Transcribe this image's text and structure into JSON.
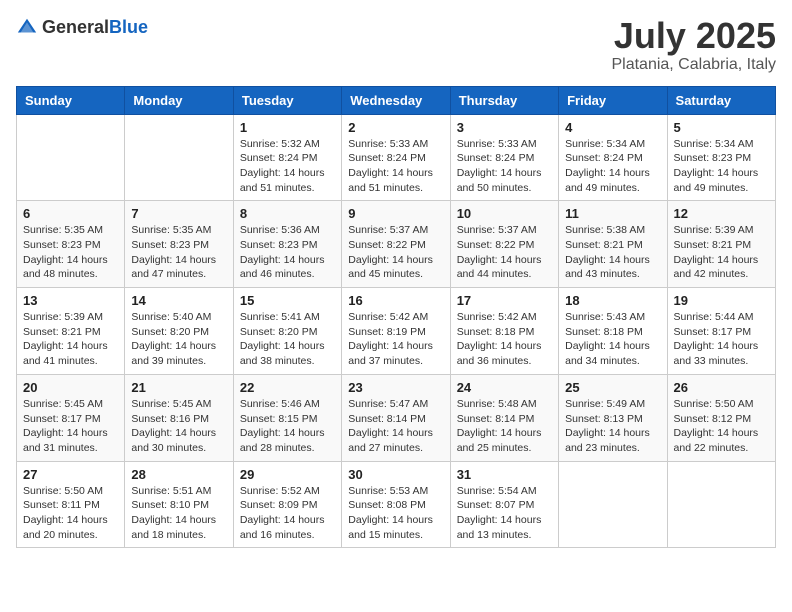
{
  "header": {
    "logo_general": "General",
    "logo_blue": "Blue",
    "month_title": "July 2025",
    "subtitle": "Platania, Calabria, Italy"
  },
  "weekdays": [
    "Sunday",
    "Monday",
    "Tuesday",
    "Wednesday",
    "Thursday",
    "Friday",
    "Saturday"
  ],
  "weeks": [
    [
      {
        "day": "",
        "sunrise": "",
        "sunset": "",
        "daylight": ""
      },
      {
        "day": "",
        "sunrise": "",
        "sunset": "",
        "daylight": ""
      },
      {
        "day": "1",
        "sunrise": "Sunrise: 5:32 AM",
        "sunset": "Sunset: 8:24 PM",
        "daylight": "Daylight: 14 hours and 51 minutes."
      },
      {
        "day": "2",
        "sunrise": "Sunrise: 5:33 AM",
        "sunset": "Sunset: 8:24 PM",
        "daylight": "Daylight: 14 hours and 51 minutes."
      },
      {
        "day": "3",
        "sunrise": "Sunrise: 5:33 AM",
        "sunset": "Sunset: 8:24 PM",
        "daylight": "Daylight: 14 hours and 50 minutes."
      },
      {
        "day": "4",
        "sunrise": "Sunrise: 5:34 AM",
        "sunset": "Sunset: 8:24 PM",
        "daylight": "Daylight: 14 hours and 49 minutes."
      },
      {
        "day": "5",
        "sunrise": "Sunrise: 5:34 AM",
        "sunset": "Sunset: 8:23 PM",
        "daylight": "Daylight: 14 hours and 49 minutes."
      }
    ],
    [
      {
        "day": "6",
        "sunrise": "Sunrise: 5:35 AM",
        "sunset": "Sunset: 8:23 PM",
        "daylight": "Daylight: 14 hours and 48 minutes."
      },
      {
        "day": "7",
        "sunrise": "Sunrise: 5:35 AM",
        "sunset": "Sunset: 8:23 PM",
        "daylight": "Daylight: 14 hours and 47 minutes."
      },
      {
        "day": "8",
        "sunrise": "Sunrise: 5:36 AM",
        "sunset": "Sunset: 8:23 PM",
        "daylight": "Daylight: 14 hours and 46 minutes."
      },
      {
        "day": "9",
        "sunrise": "Sunrise: 5:37 AM",
        "sunset": "Sunset: 8:22 PM",
        "daylight": "Daylight: 14 hours and 45 minutes."
      },
      {
        "day": "10",
        "sunrise": "Sunrise: 5:37 AM",
        "sunset": "Sunset: 8:22 PM",
        "daylight": "Daylight: 14 hours and 44 minutes."
      },
      {
        "day": "11",
        "sunrise": "Sunrise: 5:38 AM",
        "sunset": "Sunset: 8:21 PM",
        "daylight": "Daylight: 14 hours and 43 minutes."
      },
      {
        "day": "12",
        "sunrise": "Sunrise: 5:39 AM",
        "sunset": "Sunset: 8:21 PM",
        "daylight": "Daylight: 14 hours and 42 minutes."
      }
    ],
    [
      {
        "day": "13",
        "sunrise": "Sunrise: 5:39 AM",
        "sunset": "Sunset: 8:21 PM",
        "daylight": "Daylight: 14 hours and 41 minutes."
      },
      {
        "day": "14",
        "sunrise": "Sunrise: 5:40 AM",
        "sunset": "Sunset: 8:20 PM",
        "daylight": "Daylight: 14 hours and 39 minutes."
      },
      {
        "day": "15",
        "sunrise": "Sunrise: 5:41 AM",
        "sunset": "Sunset: 8:20 PM",
        "daylight": "Daylight: 14 hours and 38 minutes."
      },
      {
        "day": "16",
        "sunrise": "Sunrise: 5:42 AM",
        "sunset": "Sunset: 8:19 PM",
        "daylight": "Daylight: 14 hours and 37 minutes."
      },
      {
        "day": "17",
        "sunrise": "Sunrise: 5:42 AM",
        "sunset": "Sunset: 8:18 PM",
        "daylight": "Daylight: 14 hours and 36 minutes."
      },
      {
        "day": "18",
        "sunrise": "Sunrise: 5:43 AM",
        "sunset": "Sunset: 8:18 PM",
        "daylight": "Daylight: 14 hours and 34 minutes."
      },
      {
        "day": "19",
        "sunrise": "Sunrise: 5:44 AM",
        "sunset": "Sunset: 8:17 PM",
        "daylight": "Daylight: 14 hours and 33 minutes."
      }
    ],
    [
      {
        "day": "20",
        "sunrise": "Sunrise: 5:45 AM",
        "sunset": "Sunset: 8:17 PM",
        "daylight": "Daylight: 14 hours and 31 minutes."
      },
      {
        "day": "21",
        "sunrise": "Sunrise: 5:45 AM",
        "sunset": "Sunset: 8:16 PM",
        "daylight": "Daylight: 14 hours and 30 minutes."
      },
      {
        "day": "22",
        "sunrise": "Sunrise: 5:46 AM",
        "sunset": "Sunset: 8:15 PM",
        "daylight": "Daylight: 14 hours and 28 minutes."
      },
      {
        "day": "23",
        "sunrise": "Sunrise: 5:47 AM",
        "sunset": "Sunset: 8:14 PM",
        "daylight": "Daylight: 14 hours and 27 minutes."
      },
      {
        "day": "24",
        "sunrise": "Sunrise: 5:48 AM",
        "sunset": "Sunset: 8:14 PM",
        "daylight": "Daylight: 14 hours and 25 minutes."
      },
      {
        "day": "25",
        "sunrise": "Sunrise: 5:49 AM",
        "sunset": "Sunset: 8:13 PM",
        "daylight": "Daylight: 14 hours and 23 minutes."
      },
      {
        "day": "26",
        "sunrise": "Sunrise: 5:50 AM",
        "sunset": "Sunset: 8:12 PM",
        "daylight": "Daylight: 14 hours and 22 minutes."
      }
    ],
    [
      {
        "day": "27",
        "sunrise": "Sunrise: 5:50 AM",
        "sunset": "Sunset: 8:11 PM",
        "daylight": "Daylight: 14 hours and 20 minutes."
      },
      {
        "day": "28",
        "sunrise": "Sunrise: 5:51 AM",
        "sunset": "Sunset: 8:10 PM",
        "daylight": "Daylight: 14 hours and 18 minutes."
      },
      {
        "day": "29",
        "sunrise": "Sunrise: 5:52 AM",
        "sunset": "Sunset: 8:09 PM",
        "daylight": "Daylight: 14 hours and 16 minutes."
      },
      {
        "day": "30",
        "sunrise": "Sunrise: 5:53 AM",
        "sunset": "Sunset: 8:08 PM",
        "daylight": "Daylight: 14 hours and 15 minutes."
      },
      {
        "day": "31",
        "sunrise": "Sunrise: 5:54 AM",
        "sunset": "Sunset: 8:07 PM",
        "daylight": "Daylight: 14 hours and 13 minutes."
      },
      {
        "day": "",
        "sunrise": "",
        "sunset": "",
        "daylight": ""
      },
      {
        "day": "",
        "sunrise": "",
        "sunset": "",
        "daylight": ""
      }
    ]
  ]
}
